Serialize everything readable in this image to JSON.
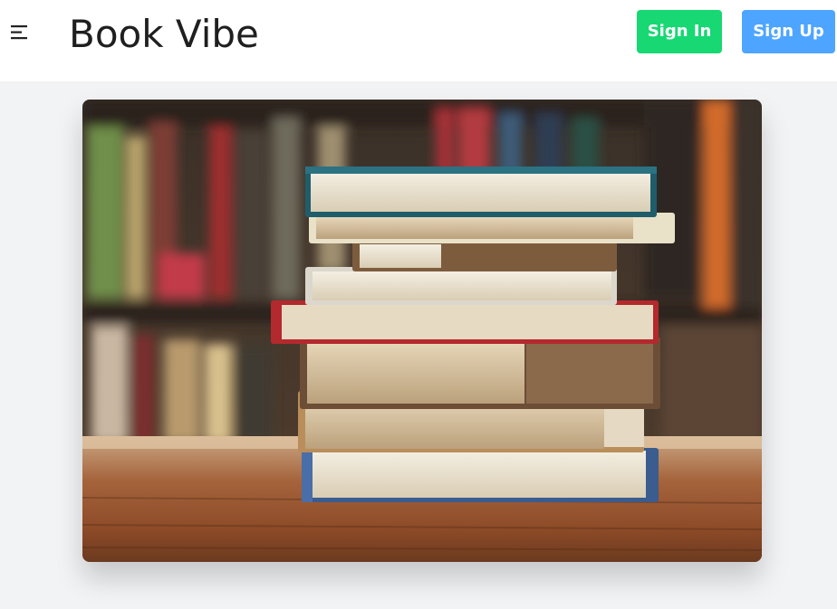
{
  "header": {
    "brand": "Book Vibe",
    "sign_in_label": "Sign In",
    "sign_up_label": "Sign Up",
    "menu_icon": "hamburger-menu-icon"
  },
  "colors": {
    "sign_in": "#17d873",
    "sign_up": "#4ea5ff",
    "page_bg": "#f2f3f5",
    "header_bg": "#ffffff"
  },
  "hero": {
    "image_subject": "stack of books on wooden table in front of bookshelf"
  }
}
